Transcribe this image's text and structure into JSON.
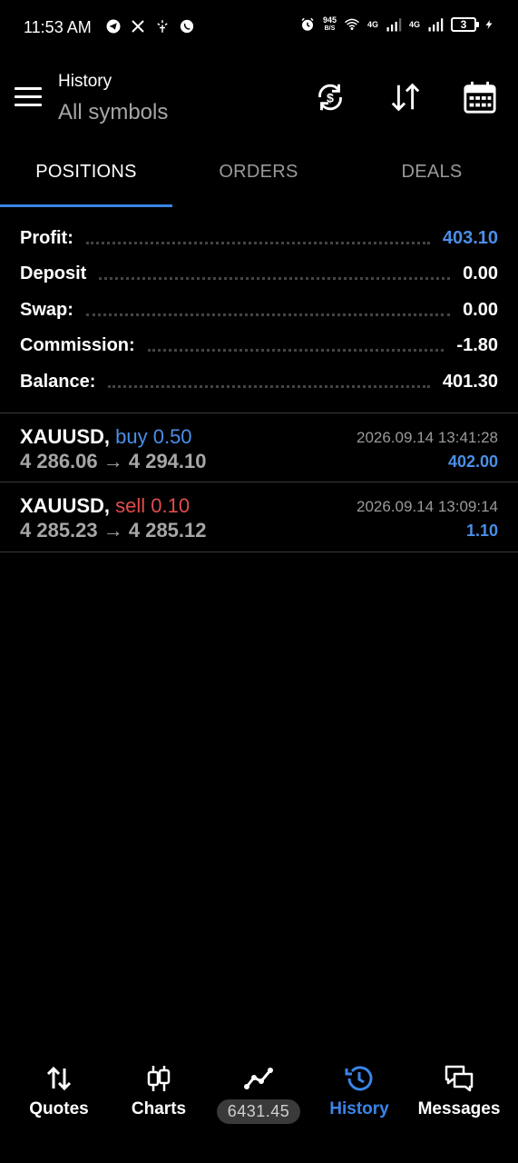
{
  "status_bar": {
    "time": "11:53 AM",
    "net_speed_value": "945",
    "net_speed_unit": "B/S",
    "net_type_1": "4G",
    "net_type_2": "4G",
    "battery": "3"
  },
  "header": {
    "title": "History",
    "subtitle": "All symbols",
    "icons": [
      "sync-icon",
      "sort-icon",
      "calendar-icon"
    ]
  },
  "tabs": [
    {
      "label": "POSITIONS",
      "active": true
    },
    {
      "label": "ORDERS",
      "active": false
    },
    {
      "label": "DEALS",
      "active": false
    }
  ],
  "summary": [
    {
      "label": "Profit:",
      "value": "403.10",
      "highlight": true
    },
    {
      "label": "Deposit",
      "value": "0.00"
    },
    {
      "label": "Swap:",
      "value": "0.00"
    },
    {
      "label": "Commission:",
      "value": "-1.80"
    },
    {
      "label": "Balance:",
      "value": "401.30"
    }
  ],
  "deals": [
    {
      "symbol": "XAUUSD,",
      "type": "buy 0.50",
      "side": "buy",
      "prices": "4 286.06 → 4 294.10",
      "time": "2026.09.14 13:41:28",
      "profit": "402.00"
    },
    {
      "symbol": "XAUUSD,",
      "type": "sell 0.10",
      "side": "sell",
      "prices": "4 285.23 → 4 285.12",
      "time": "2026.09.14 13:09:14",
      "profit": "1.10"
    }
  ],
  "bottom_nav": [
    {
      "label": "Quotes",
      "icon": "quotes-icon"
    },
    {
      "label": "Charts",
      "icon": "candlestick-icon"
    },
    {
      "label": "6431.45",
      "icon": "trade-icon"
    },
    {
      "label": "History",
      "icon": "history-icon",
      "active": true
    },
    {
      "label": "Messages",
      "icon": "messages-icon"
    }
  ],
  "colors": {
    "accent": "#3a85e8",
    "buy": "#4a8fe7",
    "sell": "#e24c4c",
    "background": "#000000"
  }
}
